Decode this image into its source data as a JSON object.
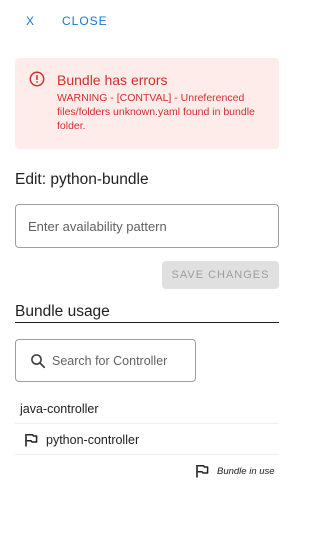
{
  "header": {
    "close_icon": "X",
    "close_label": "CLOSE"
  },
  "alert": {
    "icon": "error-circle-icon",
    "title": "Bundle has errors",
    "message": "WARNING - [CONTVAL] - Unreferenced files/folders unknown.yaml found in bundle folder.",
    "color": "#d32f2f",
    "background": "#fdecea"
  },
  "edit": {
    "title": "Edit: python-bundle",
    "pattern_placeholder": "Enter availability pattern",
    "pattern_value": "",
    "save_label": "SAVE CHANGES"
  },
  "usage": {
    "title": "Bundle usage",
    "search_placeholder": "Search for Controller",
    "search_value": "",
    "controllers": [
      {
        "name": "java-controller",
        "in_use": false
      },
      {
        "name": "python-controller",
        "in_use": true
      }
    ],
    "legend_label": "Bundle in use"
  },
  "colors": {
    "accent": "#1976d2"
  }
}
